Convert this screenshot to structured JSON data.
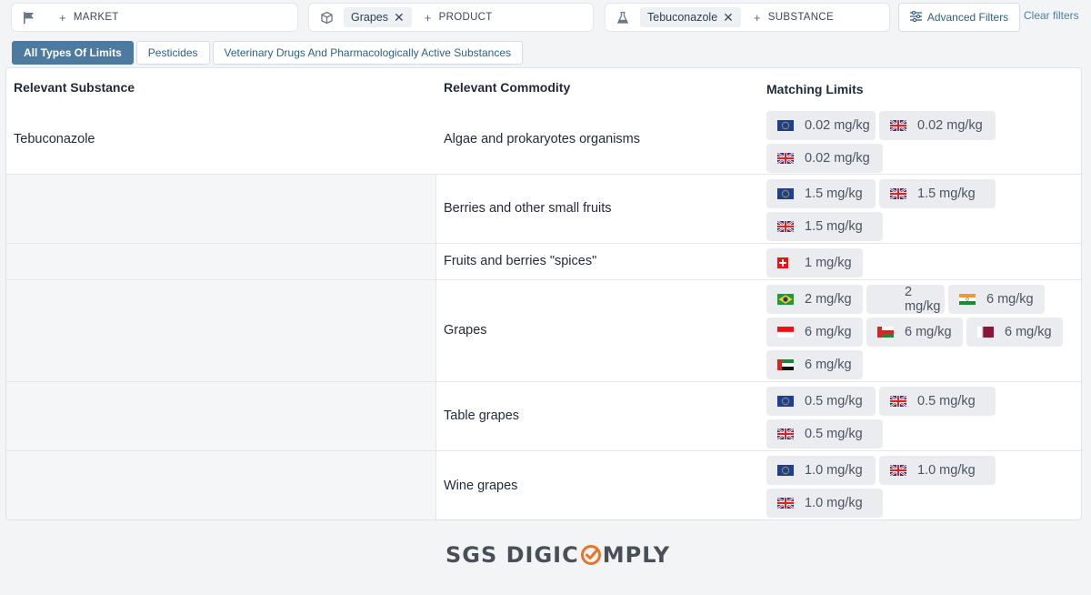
{
  "filters": {
    "market": {
      "add_label": "MARKET",
      "icon": "flag-icon"
    },
    "product": {
      "chip": "Grapes",
      "add_label": "PRODUCT",
      "icon": "cube-icon"
    },
    "substance": {
      "chip": "Tebuconazole",
      "add_label": "SUBSTANCE",
      "icon": "flask-icon"
    },
    "advanced_label": "Advanced Filters",
    "clear_label": "Clear filters"
  },
  "tabs": [
    {
      "label": "All Types Of Limits",
      "active": true
    },
    {
      "label": "Pesticides",
      "active": false
    },
    {
      "label": "Veterinary Drugs And Pharmacologically Active Substances",
      "active": false
    }
  ],
  "table": {
    "headers": {
      "substance": "Relevant Substance",
      "commodity": "Relevant Commodity",
      "limits": "Matching Limits"
    },
    "rows": [
      {
        "substance": "Tebuconazole",
        "commodity": "Algae and prokaryotes organisms",
        "limits": [
          {
            "flag": "eu",
            "value": "0.02 mg/kg"
          },
          {
            "flag": "uk",
            "value": "0.02 mg/kg"
          },
          {
            "flag": "uk",
            "value": "0.02 mg/kg"
          }
        ]
      },
      {
        "substance": "",
        "commodity": "Berries and other small fruits",
        "limits": [
          {
            "flag": "eu",
            "value": "1.5 mg/kg"
          },
          {
            "flag": "uk",
            "value": "1.5 mg/kg"
          },
          {
            "flag": "uk",
            "value": "1.5 mg/kg"
          }
        ]
      },
      {
        "substance": "",
        "commodity": "Fruits and berries \"spices\"",
        "limits": [
          {
            "flag": "ch",
            "value": "1 mg/kg"
          }
        ]
      },
      {
        "substance": "",
        "commodity": "Grapes",
        "limits": [
          {
            "flag": "br",
            "value": "2 mg/kg"
          },
          {
            "flag": "none",
            "value": "2 mg/kg"
          },
          {
            "flag": "in",
            "value": "6 mg/kg"
          },
          {
            "flag": "id",
            "value": "6 mg/kg"
          },
          {
            "flag": "om",
            "value": "6 mg/kg"
          },
          {
            "flag": "qa",
            "value": "6 mg/kg"
          },
          {
            "flag": "ae",
            "value": "6 mg/kg"
          }
        ]
      },
      {
        "substance": "",
        "commodity": "Table grapes",
        "limits": [
          {
            "flag": "eu",
            "value": "0.5 mg/kg"
          },
          {
            "flag": "uk",
            "value": "0.5 mg/kg"
          },
          {
            "flag": "uk",
            "value": "0.5 mg/kg"
          }
        ]
      },
      {
        "substance": "",
        "commodity": "Wine grapes",
        "limits": [
          {
            "flag": "eu",
            "value": "1.0 mg/kg"
          },
          {
            "flag": "uk",
            "value": "1.0 mg/kg"
          },
          {
            "flag": "uk",
            "value": "1.0 mg/kg"
          }
        ]
      }
    ]
  },
  "footer": {
    "logo_text_a": "SGS DIGIC",
    "logo_text_b": "MPLY"
  }
}
